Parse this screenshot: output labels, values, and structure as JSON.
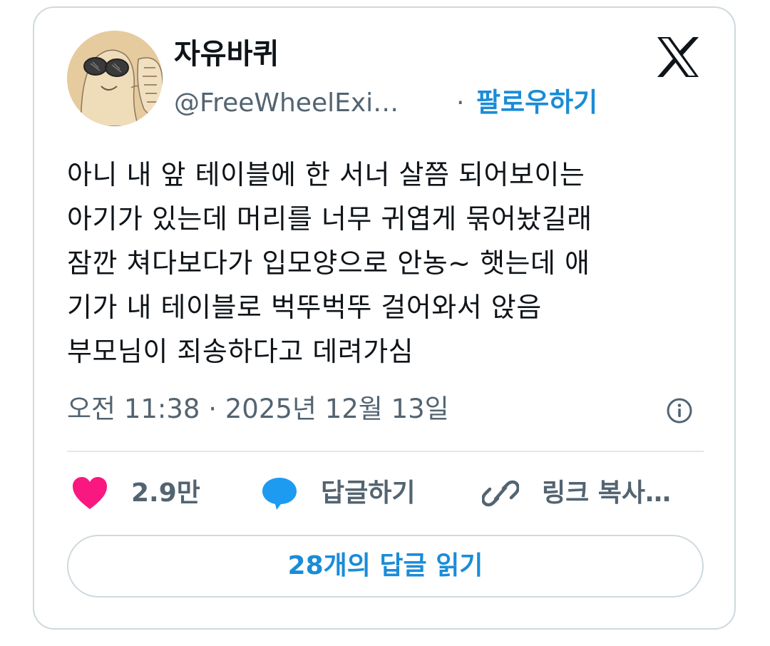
{
  "author": {
    "display_name": "자유바퀴",
    "handle": "@FreeWheelExi…",
    "separator": "·",
    "follow_label": "팔로우하기",
    "avatar_icon": "hand-drawn-avatar-with-sunglasses"
  },
  "platform_icon": "x-logo-icon",
  "tweet": {
    "lines": [
      "아니 내 앞 테이블에 한 서너 살쯤 되어보이는",
      "아기가 있는데 머리를 너무 귀엽게 묶어놨길래",
      "잠깐 쳐다보다가 입모양으로 안농~ 햇는데 애",
      "기가 내 테이블로 벅뚜벅뚜 걸어와서 앉음",
      "부모님이 죄송하다고 데려가심"
    ],
    "timestamp": "오전 11:38 · 2025년 12월 13일"
  },
  "actions": {
    "like_count": "2.9만",
    "reply_label": "답글하기",
    "copy_link_label": "링크 복사…"
  },
  "read_replies_label": "28개의 답글 읽기",
  "colors": {
    "like": "#f91880",
    "reply": "#1d9bf0",
    "link": "#1a8cd8",
    "muted": "#536471",
    "border": "#cfd9de"
  }
}
